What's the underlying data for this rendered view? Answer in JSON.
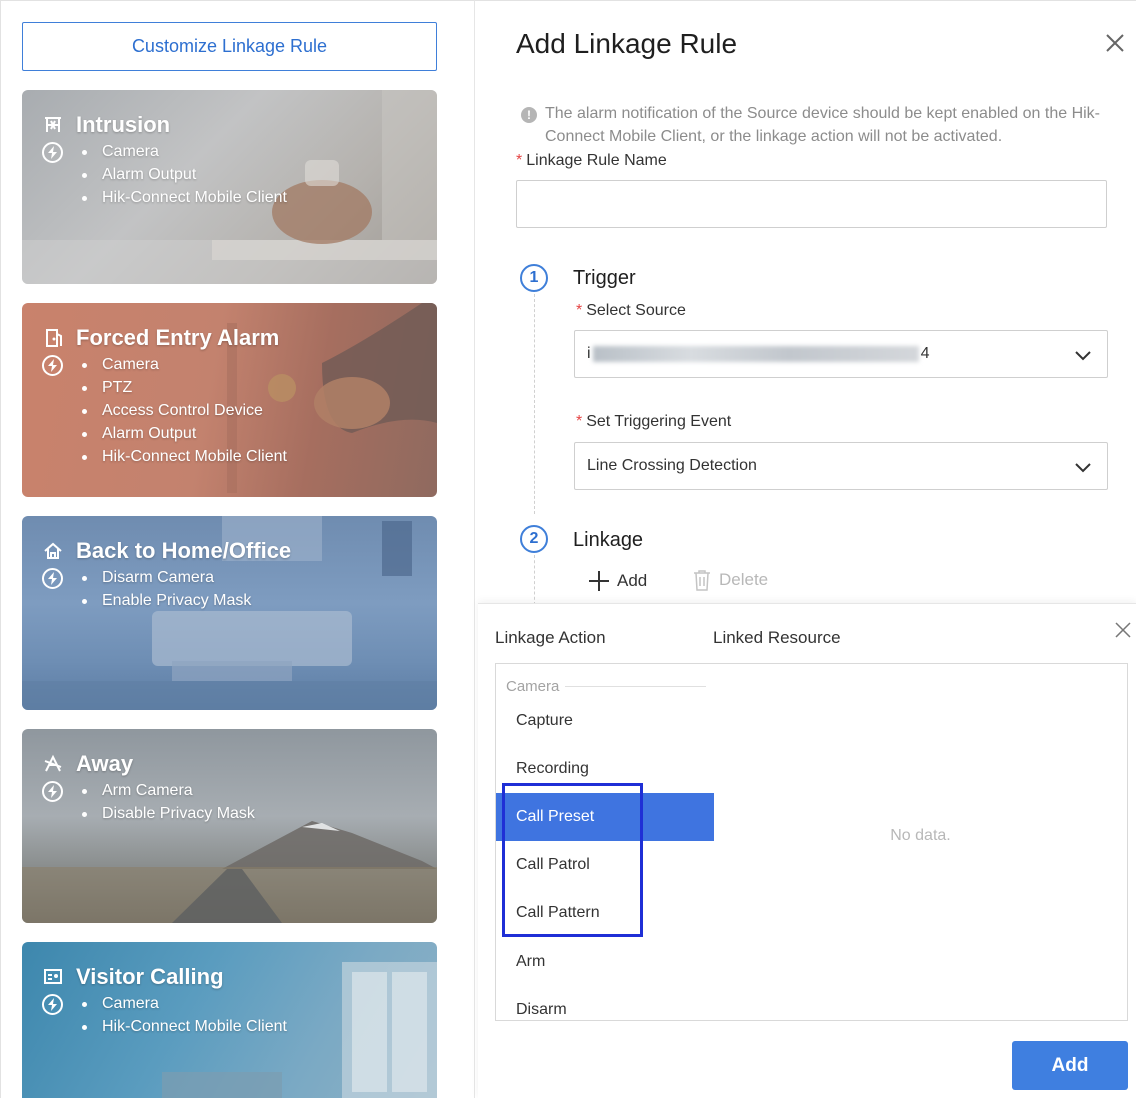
{
  "left": {
    "customize_label": "Customize Linkage Rule",
    "cards": [
      {
        "title": "Intrusion",
        "icon": "intrusion-icon",
        "items": [
          "Camera",
          "Alarm Output",
          "Hik-Connect Mobile Client"
        ]
      },
      {
        "title": "Forced Entry Alarm",
        "icon": "door-icon",
        "items": [
          "Camera",
          "PTZ",
          "Access Control Device",
          "Alarm Output",
          "Hik-Connect Mobile Client"
        ]
      },
      {
        "title": "Back to Home/Office",
        "icon": "home-icon",
        "items": [
          "Disarm Camera",
          "Enable Privacy Mask"
        ]
      },
      {
        "title": "Away",
        "icon": "away-icon",
        "items": [
          "Arm Camera",
          "Disable Privacy Mask"
        ]
      },
      {
        "title": "Visitor Calling",
        "icon": "visitor-icon",
        "items": [
          "Camera",
          "Hik-Connect Mobile Client"
        ]
      }
    ]
  },
  "panel": {
    "title": "Add Linkage Rule",
    "notice": "The alarm notification of the Source device should be kept enabled on the Hik-Connect Mobile Client, or the linkage action will not be activated.",
    "name_label": "Linkage Rule Name",
    "name_value": "",
    "trigger": {
      "step": "1",
      "title": "Trigger",
      "source_label": "Select Source",
      "source_value_prefix": "i",
      "source_value_suffix": "4",
      "event_label": "Set Triggering Event",
      "event_value": "Line Crossing Detection"
    },
    "linkage": {
      "step": "2",
      "title": "Linkage",
      "add_label": "Add",
      "delete_label": "Delete"
    }
  },
  "popup": {
    "action_header": "Linkage Action",
    "resource_header": "Linked Resource",
    "group": "Camera",
    "actions": [
      "Capture",
      "Recording",
      "Call Preset",
      "Call Patrol",
      "Call Pattern",
      "Arm",
      "Disarm"
    ],
    "selected_action": "Call Preset",
    "no_data": "No data.",
    "add_button": "Add"
  },
  "colors": {
    "accent": "#3f7fd9",
    "selected_bg": "#3f74e0",
    "required": "#e54545",
    "highlight_box": "#1f2fd6"
  }
}
